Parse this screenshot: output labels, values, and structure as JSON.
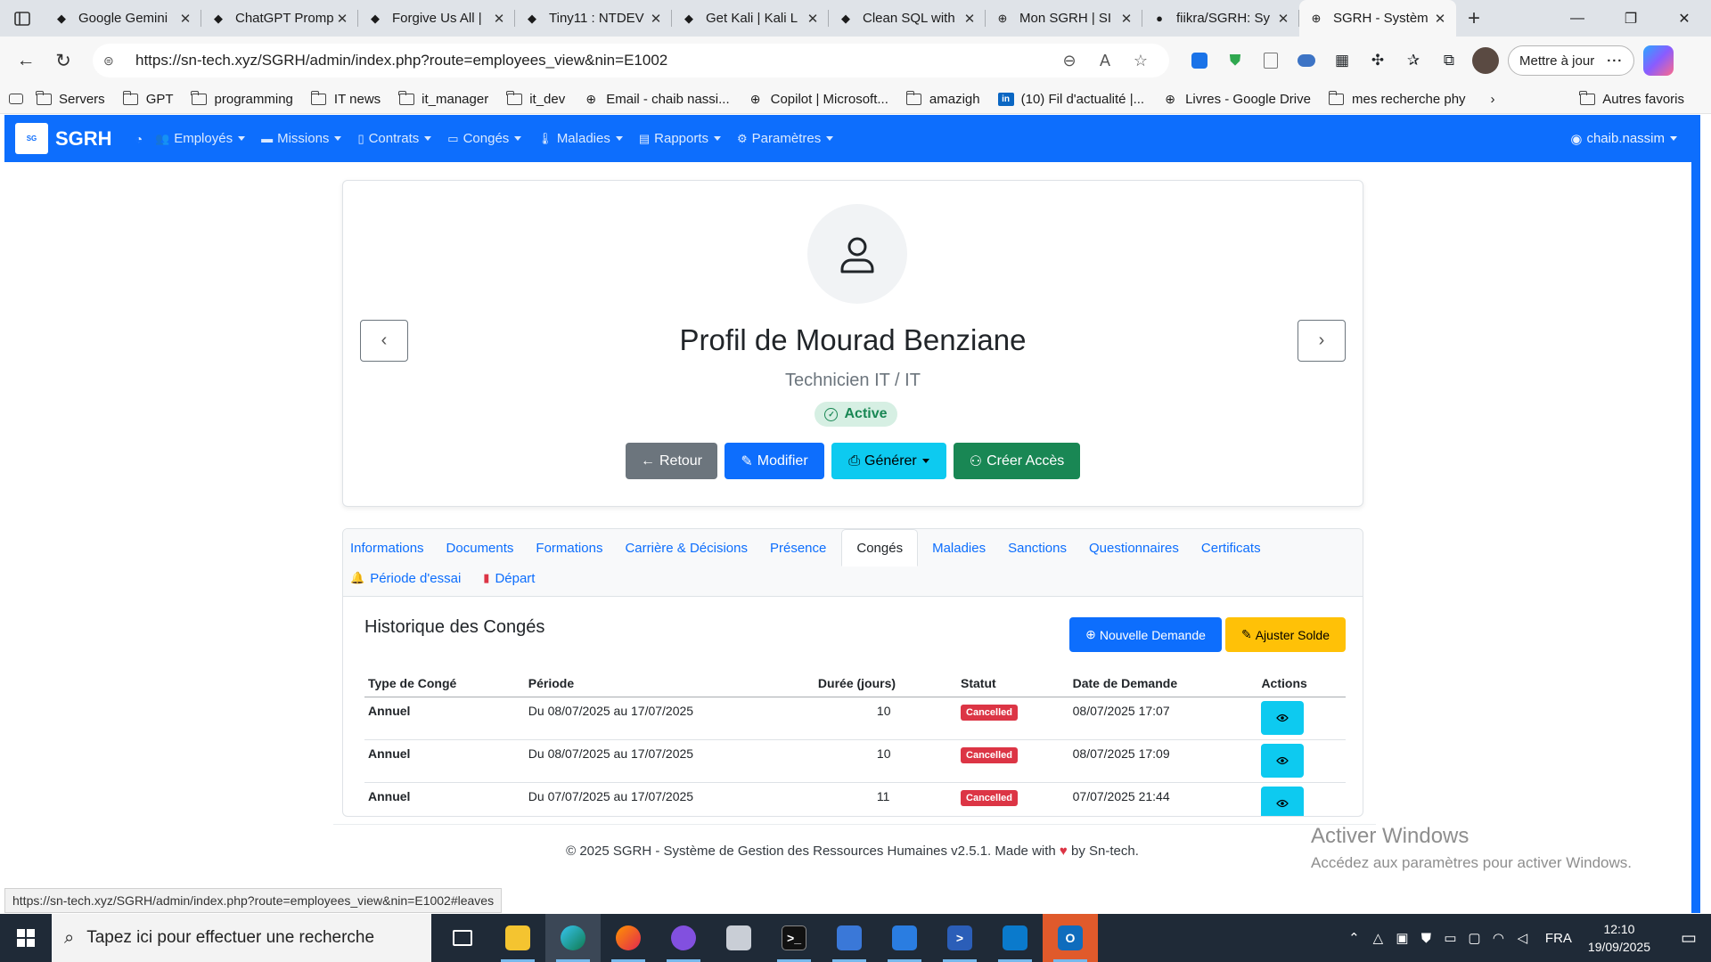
{
  "browser": {
    "tabs": [
      {
        "title": "Google Gemini",
        "icon": "gemini-icon",
        "active": false
      },
      {
        "title": "ChatGPT Promp",
        "icon": "chatgpt-icon",
        "active": false
      },
      {
        "title": "Forgive Us All |",
        "icon": "doc-icon",
        "active": false
      },
      {
        "title": "Tiny11 : NTDEV",
        "icon": "archive-icon",
        "active": false
      },
      {
        "title": "Get Kali | Kali L",
        "icon": "kali-icon",
        "active": false
      },
      {
        "title": "Clean SQL with",
        "icon": "openai-icon",
        "active": false
      },
      {
        "title": "Mon SGRH | SI",
        "icon": "globe-icon",
        "active": false
      },
      {
        "title": "fiikra/SGRH: Sy",
        "icon": "github-icon",
        "active": false
      },
      {
        "title": "SGRH - Systèm",
        "icon": "globe-icon",
        "active": true
      }
    ],
    "url": "https://sn-tech.xyz/SGRH/admin/index.php?route=employees_view&nin=E1002",
    "update_label": "Mettre à jour",
    "bookmarks": [
      {
        "label": "Servers",
        "icon": "folder-icon"
      },
      {
        "label": "GPT",
        "icon": "folder-icon"
      },
      {
        "label": "programming",
        "icon": "folder-icon"
      },
      {
        "label": "IT news",
        "icon": "folder-icon"
      },
      {
        "label": "it_manager",
        "icon": "folder-icon"
      },
      {
        "label": "it_dev",
        "icon": "folder-icon"
      },
      {
        "label": "Email - chaib nassi...",
        "icon": "globe-icon"
      },
      {
        "label": "Copilot | Microsoft...",
        "icon": "globe-icon"
      },
      {
        "label": "amazigh",
        "icon": "folder-icon"
      },
      {
        "label": "(10) Fil d'actualité |...",
        "icon": "linkedin-icon"
      },
      {
        "label": "Livres - Google Drive",
        "icon": "globe-icon"
      },
      {
        "label": "mes recherche phy",
        "icon": "folder-icon"
      }
    ],
    "other_bookmarks": "Autres favoris"
  },
  "app": {
    "brand": "SGRH",
    "menu": [
      {
        "label": "Employés",
        "icon": "users-icon"
      },
      {
        "label": "Missions",
        "icon": "briefcase-icon"
      },
      {
        "label": "Contrats",
        "icon": "file-icon"
      },
      {
        "label": "Congés",
        "icon": "calendar-icon"
      },
      {
        "label": "Maladies",
        "icon": "thermometer-icon"
      },
      {
        "label": "Rapports",
        "icon": "report-icon"
      },
      {
        "label": "Paramètres",
        "icon": "gear-icon"
      }
    ],
    "user": "chaib.nassim"
  },
  "profile": {
    "name": "Profil de Mourad Benziane",
    "role": "Technicien IT / IT",
    "status": "Active",
    "buttons": {
      "back": "Retour",
      "edit": "Modifier",
      "generate": "Générer",
      "create_access": "Créer Accès"
    }
  },
  "tabs": {
    "row1": [
      "Informations",
      "Documents",
      "Formations",
      "Carrière & Décisions",
      "Présence",
      "Congés",
      "Maladies",
      "Sanctions",
      "Questionnaires",
      "Certificats"
    ],
    "row2": [
      {
        "label": "Période d'essai",
        "icon": "bell-icon"
      },
      {
        "label": "Départ",
        "icon": "door-icon"
      }
    ],
    "active": "Congés"
  },
  "leaves": {
    "title": "Historique des Congés",
    "new_request": "Nouvelle Demande",
    "adjust_balance": "Ajuster Solde",
    "columns": [
      "Type de Congé",
      "Période",
      "Durée (jours)",
      "Statut",
      "Date de Demande",
      "Actions"
    ],
    "rows": [
      {
        "type": "Annuel",
        "period": "Du 08/07/2025 au 17/07/2025",
        "duration": "10",
        "status": "Cancelled",
        "requested": "08/07/2025 17:07"
      },
      {
        "type": "Annuel",
        "period": "Du 08/07/2025 au 17/07/2025",
        "duration": "10",
        "status": "Cancelled",
        "requested": "08/07/2025 17:09"
      },
      {
        "type": "Annuel",
        "period": "Du 07/07/2025 au 17/07/2025",
        "duration": "11",
        "status": "Cancelled",
        "requested": "07/07/2025 21:44"
      }
    ]
  },
  "footer": {
    "prefix": "© 2025 SGRH - Système de Gestion des Ressources Humaines v2.5.1. Made with",
    "suffix": "by Sn-tech."
  },
  "watermark": {
    "line1": "Activer Windows",
    "line2": "Accédez aux paramètres pour activer Windows."
  },
  "status_url": "https://sn-tech.xyz/SGRH/admin/index.php?route=employees_view&nin=E1002#leaves",
  "taskbar": {
    "search_placeholder": "Tapez ici pour effectuer une recherche",
    "language": "FRA",
    "time": "12:10",
    "date": "19/09/2025"
  },
  "colors": {
    "primary": "#0d6efd",
    "success": "#198754",
    "info": "#0dcaf0",
    "warning": "#ffc107",
    "danger": "#dc3545",
    "secondary": "#6c757d"
  }
}
